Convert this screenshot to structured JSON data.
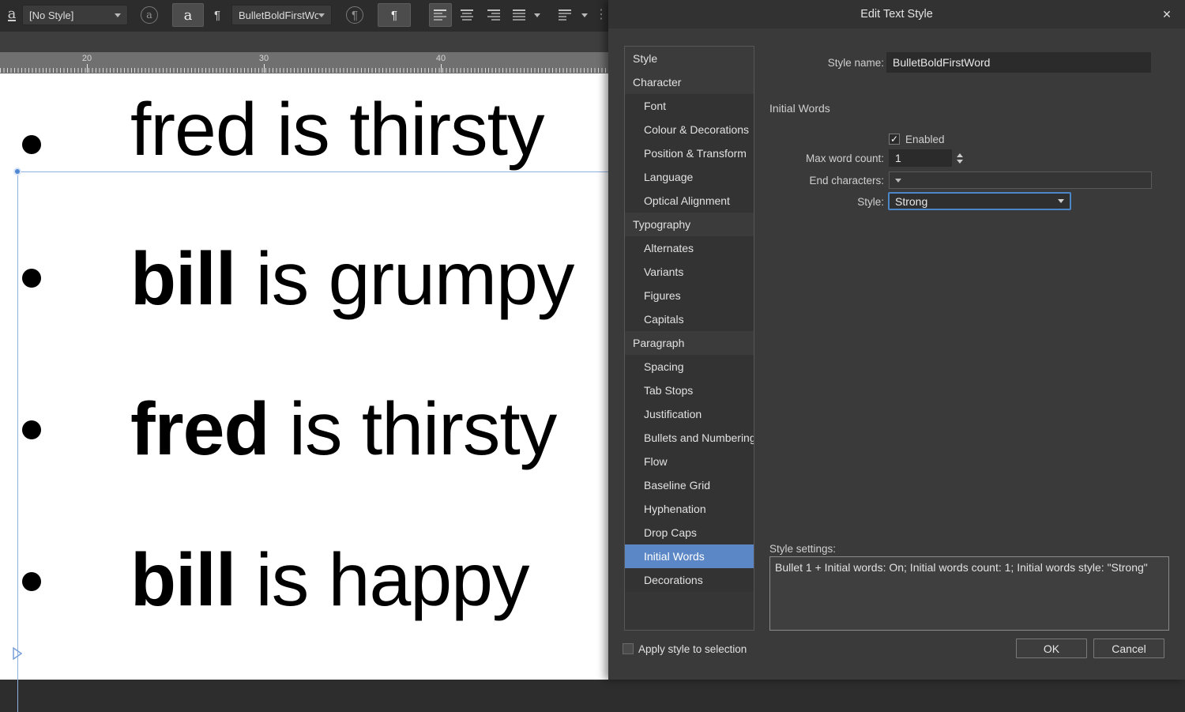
{
  "icons": {
    "close": "✕",
    "check": "✓",
    "pilcrow": "¶",
    "char_a": "a",
    "dots": "⋮"
  },
  "colors": {
    "accent_selected": "#5b87c7",
    "focus_border": "#4a86c8",
    "canvas_frame_blue": "#8fb0e0"
  },
  "toolbar": {
    "char_style_dropdown": "[No Style]",
    "para_style_dropdown": "BulletBoldFirstWor"
  },
  "ruler": {
    "marks": [
      "20",
      "30",
      "40"
    ]
  },
  "document": {
    "bullet": "•",
    "lines": [
      {
        "first": "fred",
        "rest": " is thirsty",
        "bold_first": false
      },
      {
        "first": "bill",
        "rest": " is grumpy",
        "bold_first": true
      },
      {
        "first": "fred",
        "rest": " is thirsty",
        "bold_first": true
      },
      {
        "first": "bill",
        "rest": " is happy",
        "bold_first": true
      }
    ]
  },
  "dialog": {
    "title": "Edit Text Style",
    "sidebar": [
      {
        "label": "Style"
      },
      {
        "label": "Character"
      },
      {
        "label": "Font"
      },
      {
        "label": "Colour & Decorations"
      },
      {
        "label": "Position & Transform"
      },
      {
        "label": "Language"
      },
      {
        "label": "Optical Alignment"
      },
      {
        "label": "Typography"
      },
      {
        "label": "Alternates"
      },
      {
        "label": "Variants"
      },
      {
        "label": "Figures"
      },
      {
        "label": "Capitals"
      },
      {
        "label": "Paragraph"
      },
      {
        "label": "Spacing"
      },
      {
        "label": "Tab Stops"
      },
      {
        "label": "Justification"
      },
      {
        "label": "Bullets and Numbering"
      },
      {
        "label": "Flow"
      },
      {
        "label": "Baseline Grid"
      },
      {
        "label": "Hyphenation"
      },
      {
        "label": "Drop Caps"
      },
      {
        "label": "Initial Words",
        "selected": true
      },
      {
        "label": "Decorations"
      }
    ],
    "form": {
      "style_name_label": "Style name:",
      "style_name_value": "BulletBoldFirstWord",
      "section_heading": "Initial Words",
      "enabled_label": "Enabled",
      "enabled_checked": true,
      "max_word_count_label": "Max word count:",
      "max_word_count_value": "1",
      "end_characters_label": "End characters:",
      "end_characters_value": "",
      "style_label": "Style:",
      "style_value": "Strong"
    },
    "style_settings": {
      "label": "Style settings:",
      "value": "Bullet 1 + Initial words: On; Initial words count: 1; Initial words style: \"Strong\""
    },
    "footer": {
      "apply_label": "Apply style to selection",
      "apply_checked": false,
      "ok_label": "OK",
      "cancel_label": "Cancel"
    }
  }
}
